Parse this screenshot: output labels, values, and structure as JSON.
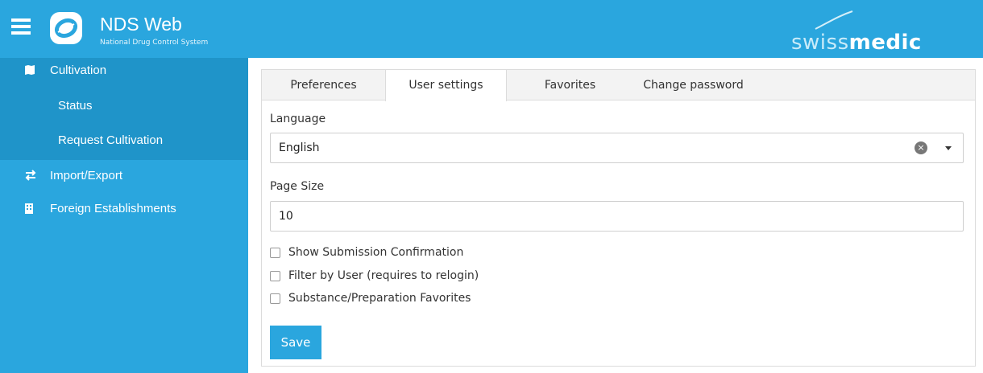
{
  "header": {
    "app_title": "NDS Web",
    "app_subtitle": "National Drug Control System",
    "brand_light": "swiss",
    "brand_bold": "medic"
  },
  "sidebar": {
    "items": [
      {
        "label": "Cultivation",
        "icon": "map-icon"
      },
      {
        "label": "Status"
      },
      {
        "label": "Request Cultivation"
      },
      {
        "label": "Import/Export",
        "icon": "exchange-icon"
      },
      {
        "label": "Foreign Establishments",
        "icon": "building-icon"
      }
    ]
  },
  "tabs": [
    {
      "label": "Preferences"
    },
    {
      "label": "User settings"
    },
    {
      "label": "Favorites"
    },
    {
      "label": "Change password"
    }
  ],
  "form": {
    "language_label": "Language",
    "language_value": "English",
    "page_size_label": "Page Size",
    "page_size_value": "10",
    "checkboxes": [
      {
        "label": "Show Submission Confirmation"
      },
      {
        "label": "Filter by User (requires to relogin)"
      },
      {
        "label": "Substance/Preparation Favorites"
      }
    ],
    "save_label": "Save"
  },
  "colors": {
    "primary": "#2aa6de",
    "sidebar_active": "#1f94c9"
  }
}
